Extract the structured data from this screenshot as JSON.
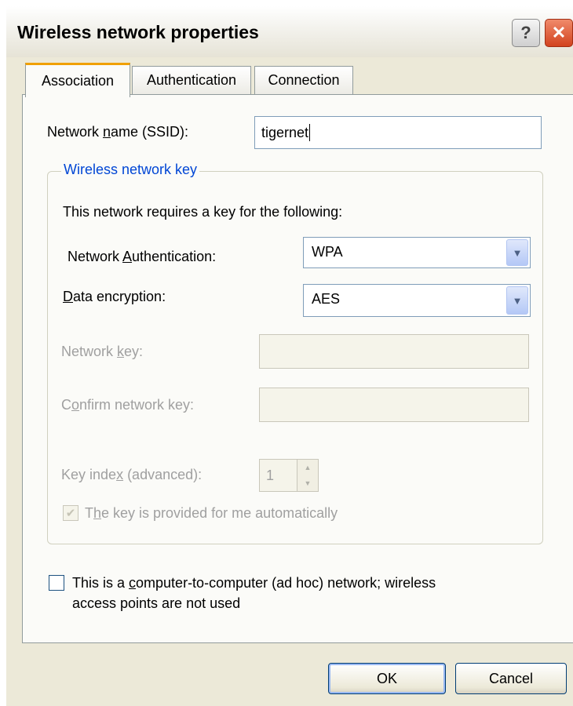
{
  "window": {
    "title": "Wireless network properties",
    "help_label": "?",
    "close_label": "✕"
  },
  "tabs": [
    {
      "label": "Association",
      "active": true
    },
    {
      "label": "Authentication",
      "active": false
    },
    {
      "label": "Connection",
      "active": false
    }
  ],
  "association": {
    "ssid": {
      "label_pre": "Network ",
      "label_key": "n",
      "label_post": "ame (SSID):",
      "value": "tigernet"
    },
    "key_group": {
      "title": "Wireless network key",
      "intro": "This network requires a key for the following:",
      "network_auth": {
        "label_pre": "Network ",
        "label_key": "A",
        "label_post": "uthentication:",
        "value": "WPA"
      },
      "data_encryption": {
        "label_pre": "",
        "label_key": "D",
        "label_post": "ata encryption:",
        "value": "AES"
      },
      "network_key": {
        "label_pre": "Network ",
        "label_key": "k",
        "label_post": "ey:",
        "value": ""
      },
      "confirm_key": {
        "label_pre": "C",
        "label_key": "o",
        "label_post": "nfirm network key:",
        "value": ""
      },
      "key_index": {
        "label_pre": "Key inde",
        "label_key": "x",
        "label_post": " (advanced):",
        "value": "1"
      },
      "auto_key": {
        "label_pre": "T",
        "label_key": "h",
        "label_post": "e key is provided for me automatically",
        "checked": true
      }
    },
    "adhoc": {
      "label_pre": "This is a ",
      "label_key": "c",
      "label_post": "omputer-to-computer (ad hoc) network; wireless",
      "label_line2": "access points are not used",
      "checked": false
    }
  },
  "buttons": {
    "ok": "OK",
    "cancel": "Cancel"
  },
  "icons": {
    "dropdown": "▼",
    "spin_up": "▲",
    "spin_down": "▼",
    "check": "✔"
  }
}
